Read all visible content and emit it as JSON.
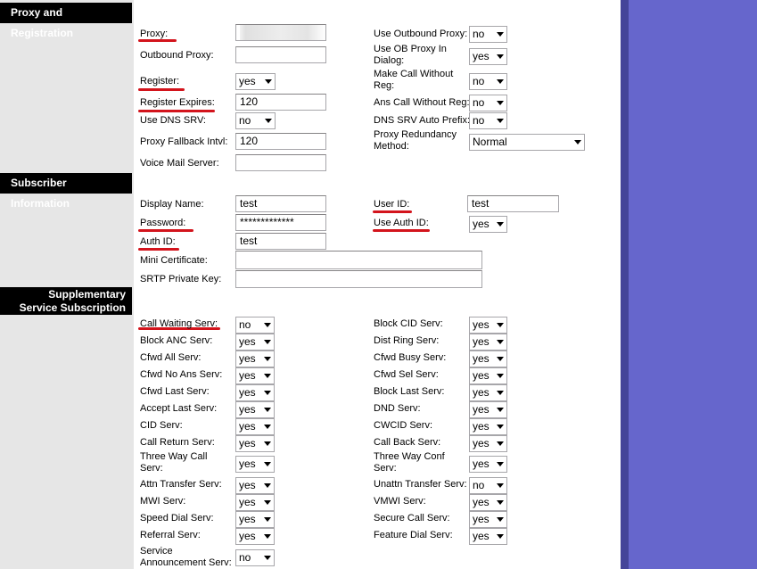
{
  "sections": {
    "proxy": "Proxy and Registration",
    "subscriber": "Subscriber Information",
    "supplementary": "Supplementary Service Subscription"
  },
  "proxy": {
    "proxy_label": "Proxy:",
    "outbound_proxy_label": "Outbound Proxy:",
    "register_label": "Register:",
    "register_value": "yes",
    "register_expires_label": "Register Expires:",
    "register_expires_value": "120",
    "use_dns_srv_label": "Use DNS SRV:",
    "use_dns_srv_value": "no",
    "proxy_fallback_label": "Proxy Fallback Intvl:",
    "proxy_fallback_value": "120",
    "voice_mail_server_label": "Voice Mail Server:",
    "use_outbound_proxy_label": "Use Outbound Proxy:",
    "use_outbound_proxy_value": "no",
    "use_ob_proxy_dialog_label": "Use OB Proxy In Dialog:",
    "use_ob_proxy_dialog_value": "yes",
    "make_call_without_reg_label": "Make Call Without Reg:",
    "make_call_without_reg_value": "no",
    "ans_call_without_reg_label": "Ans Call Without Reg:",
    "ans_call_without_reg_value": "no",
    "dns_srv_auto_prefix_label": "DNS SRV Auto Prefix:",
    "dns_srv_auto_prefix_value": "no",
    "proxy_redundancy_label": "Proxy Redundancy Method:",
    "proxy_redundancy_value": "Normal"
  },
  "subscriber": {
    "display_name_label": "Display Name:",
    "display_name_value": "test",
    "password_label": "Password:",
    "password_value": "*************",
    "auth_id_label": "Auth ID:",
    "auth_id_value": "test",
    "mini_certificate_label": "Mini Certificate:",
    "srtp_private_key_label": "SRTP Private Key:",
    "user_id_label": "User ID:",
    "user_id_value": "test",
    "use_auth_id_label": "Use Auth ID:",
    "use_auth_id_value": "yes"
  },
  "services": {
    "left": [
      {
        "label": "Call Waiting Serv:",
        "value": "no"
      },
      {
        "label": "Block ANC Serv:",
        "value": "yes"
      },
      {
        "label": "Cfwd All Serv:",
        "value": "yes"
      },
      {
        "label": "Cfwd No Ans Serv:",
        "value": "yes"
      },
      {
        "label": "Cfwd Last Serv:",
        "value": "yes"
      },
      {
        "label": "Accept Last Serv:",
        "value": "yes"
      },
      {
        "label": "CID Serv:",
        "value": "yes"
      },
      {
        "label": "Call Return Serv:",
        "value": "yes"
      },
      {
        "label": "Three Way Call Serv:",
        "value": "yes"
      },
      {
        "label": "Attn Transfer Serv:",
        "value": "yes"
      },
      {
        "label": "MWI Serv:",
        "value": "yes"
      },
      {
        "label": "Speed Dial Serv:",
        "value": "yes"
      },
      {
        "label": "Referral Serv:",
        "value": "yes"
      },
      {
        "label": "Service Announcement Serv:",
        "value": "no"
      }
    ],
    "right": [
      {
        "label": "Block CID Serv:",
        "value": "yes"
      },
      {
        "label": "Dist Ring Serv:",
        "value": "yes"
      },
      {
        "label": "Cfwd Busy Serv:",
        "value": "yes"
      },
      {
        "label": "Cfwd Sel Serv:",
        "value": "yes"
      },
      {
        "label": "Block Last Serv:",
        "value": "yes"
      },
      {
        "label": "DND Serv:",
        "value": "yes"
      },
      {
        "label": "CWCID Serv:",
        "value": "yes"
      },
      {
        "label": "Call Back Serv:",
        "value": "yes"
      },
      {
        "label": "Three Way Conf Serv:",
        "value": "yes"
      },
      {
        "label": "Unattn Transfer Serv:",
        "value": "no"
      },
      {
        "label": "VMWI Serv:",
        "value": "yes"
      },
      {
        "label": "Secure Call Serv:",
        "value": "yes"
      },
      {
        "label": "Feature Dial Serv:",
        "value": "yes"
      }
    ]
  },
  "colors": {
    "sidebar": "#e6e6e6",
    "header": "#000000",
    "right_pane": "#6666cc",
    "annotation_underline": "#d3141c"
  }
}
